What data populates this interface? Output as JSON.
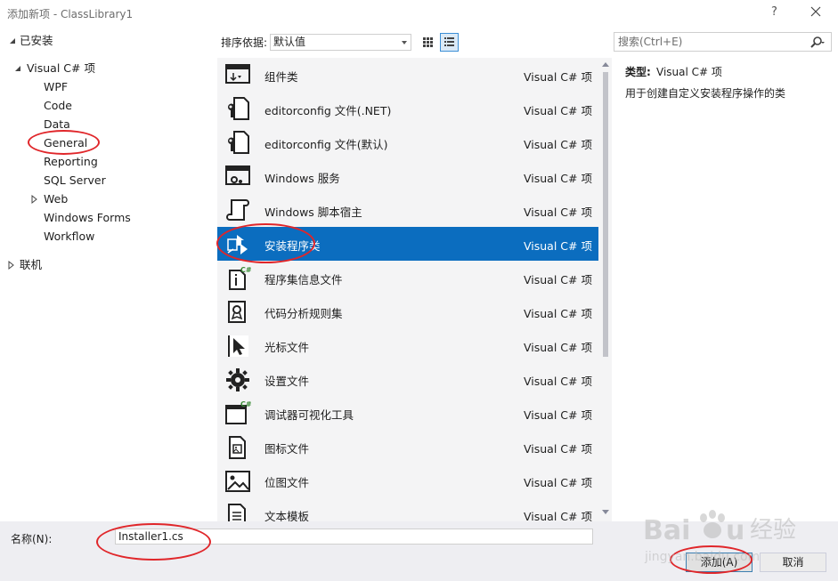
{
  "window": {
    "title": "添加新项 - ClassLibrary1",
    "help": "?"
  },
  "tree": {
    "installed": "已安装",
    "visual_csharp": "Visual C# 项",
    "children": [
      "WPF",
      "Code",
      "Data",
      "General",
      "Reporting",
      "SQL Server",
      "Web",
      "Windows Forms",
      "Workflow"
    ],
    "online": "联机"
  },
  "toolbar": {
    "sort_label": "排序依据:",
    "sort_value": "默认值",
    "search_placeholder": "搜索(Ctrl+E)"
  },
  "items": [
    {
      "name": "组件类",
      "lang": "Visual C# 项",
      "icon": "component-class-icon"
    },
    {
      "name": "editorconfig 文件(.NET)",
      "lang": "Visual C# 项",
      "icon": "editorconfig-icon"
    },
    {
      "name": "editorconfig 文件(默认)",
      "lang": "Visual C# 项",
      "icon": "editorconfig-icon"
    },
    {
      "name": "Windows 服务",
      "lang": "Visual C# 项",
      "icon": "windows-service-icon"
    },
    {
      "name": "Windows 脚本宿主",
      "lang": "Visual C# 项",
      "icon": "script-host-icon"
    },
    {
      "name": "安装程序类",
      "lang": "Visual C# 项",
      "icon": "installer-class-icon",
      "selected": true
    },
    {
      "name": "程序集信息文件",
      "lang": "Visual C# 项",
      "icon": "assembly-info-icon"
    },
    {
      "name": "代码分析规则集",
      "lang": "Visual C# 项",
      "icon": "ruleset-icon"
    },
    {
      "name": "光标文件",
      "lang": "Visual C# 项",
      "icon": "cursor-file-icon"
    },
    {
      "name": "设置文件",
      "lang": "Visual C# 项",
      "icon": "settings-file-icon"
    },
    {
      "name": "调试器可视化工具",
      "lang": "Visual C# 项",
      "icon": "debugger-visualizer-icon"
    },
    {
      "name": "图标文件",
      "lang": "Visual C# 项",
      "icon": "icon-file-icon"
    },
    {
      "name": "位图文件",
      "lang": "Visual C# 项",
      "icon": "bitmap-file-icon"
    },
    {
      "name": "文本模板",
      "lang": "Visual C# 项",
      "icon": "text-template-icon"
    }
  ],
  "info": {
    "type_label": "类型:",
    "type_value": "Visual C# 项",
    "description": "用于创建自定义安装程序操作的类"
  },
  "bottom": {
    "name_label": "名称(N):",
    "name_value": "Installer1.cs",
    "add_button": "添加(A)",
    "cancel_button": "取消"
  },
  "watermark": {
    "brand": "Baidu经验",
    "url": "jingyan.baidu.com"
  },
  "colors": {
    "selection": "#0b6dbf",
    "list_background": "#f4f4f5",
    "annotation": "#e0262a"
  }
}
